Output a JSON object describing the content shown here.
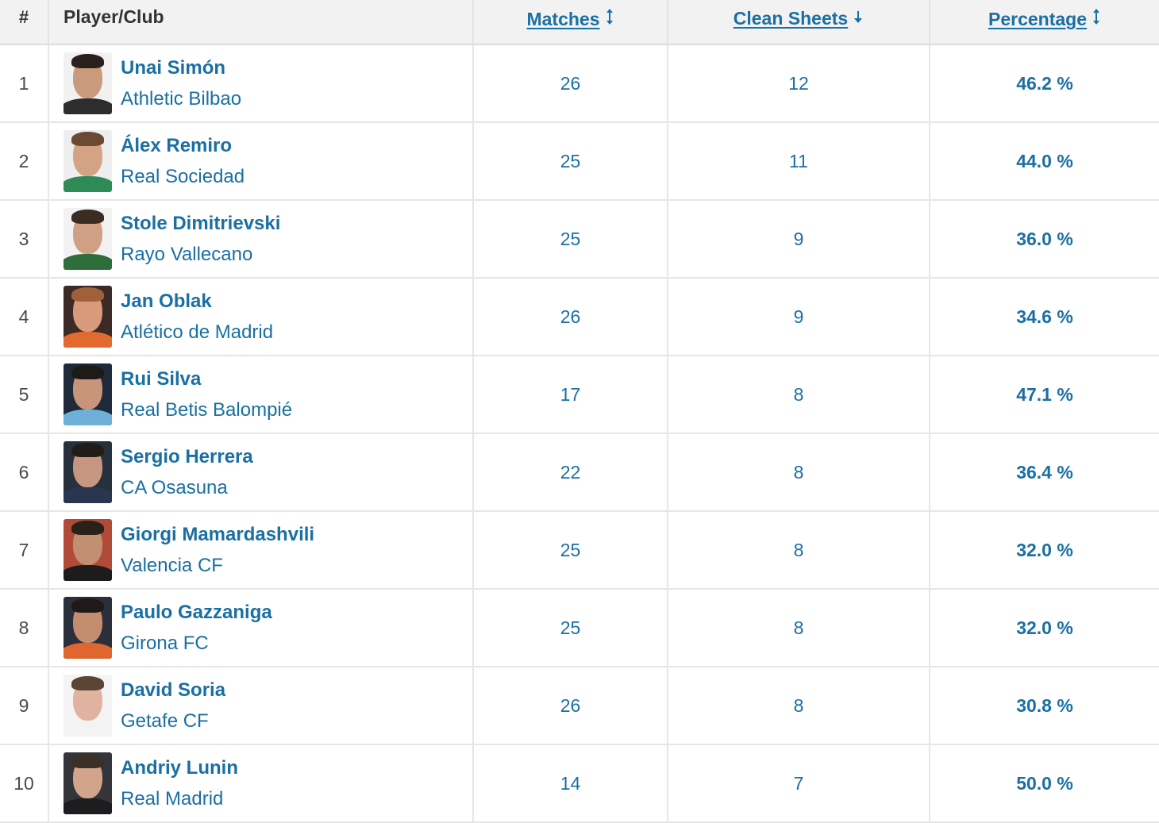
{
  "table": {
    "headers": {
      "rank": "#",
      "player_club": "Player/Club",
      "matches": "Matches",
      "clean_sheets": "Clean Sheets",
      "percentage": "Percentage"
    },
    "sort_icons": {
      "matches": "sort-both-icon",
      "clean_sheets": "sort-descending-icon",
      "percentage": "sort-both-icon"
    },
    "rows": [
      {
        "rank": "1",
        "player": "Unai Simón",
        "club": "Athletic Bilbao",
        "matches": "26",
        "clean_sheets": "12",
        "percentage": "46.2 %",
        "avatar": {
          "bg": "#f1f1f1",
          "skin": "#c99a7c",
          "hair": "#2b211c",
          "kit": "#2d2d2d"
        }
      },
      {
        "rank": "2",
        "player": "Álex Remiro",
        "club": "Real Sociedad",
        "matches": "25",
        "clean_sheets": "11",
        "percentage": "44.0 %",
        "avatar": {
          "bg": "#eeeeee",
          "skin": "#d4a386",
          "hair": "#6b4a34",
          "kit": "#2e8b57"
        }
      },
      {
        "rank": "3",
        "player": "Stole Dimitrievski",
        "club": "Rayo Vallecano",
        "matches": "25",
        "clean_sheets": "9",
        "percentage": "36.0 %",
        "avatar": {
          "bg": "#f2f2f2",
          "skin": "#cfa084",
          "hair": "#3a2c22",
          "kit": "#2f6e3a"
        }
      },
      {
        "rank": "4",
        "player": "Jan Oblak",
        "club": "Atlético de Madrid",
        "matches": "26",
        "clean_sheets": "9",
        "percentage": "34.6 %",
        "avatar": {
          "bg": "#3b2a26",
          "skin": "#d89a7a",
          "hair": "#a0603a",
          "kit": "#e36a2e"
        }
      },
      {
        "rank": "5",
        "player": "Rui Silva",
        "club": "Real Betis Balompié",
        "matches": "17",
        "clean_sheets": "8",
        "percentage": "47.1 %",
        "avatar": {
          "bg": "#1f2b3a",
          "skin": "#c9957a",
          "hair": "#1e1a18",
          "kit": "#6fb0d8"
        }
      },
      {
        "rank": "6",
        "player": "Sergio Herrera",
        "club": "CA Osasuna",
        "matches": "22",
        "clean_sheets": "8",
        "percentage": "36.4 %",
        "avatar": {
          "bg": "#27313d",
          "skin": "#c7967e",
          "hair": "#221c19",
          "kit": "#2a3550"
        }
      },
      {
        "rank": "7",
        "player": "Giorgi Mamardashvili",
        "club": "Valencia CF",
        "matches": "25",
        "clean_sheets": "8",
        "percentage": "32.0 %",
        "avatar": {
          "bg": "#b24a3a",
          "skin": "#c38f72",
          "hair": "#2a2119",
          "kit": "#1c1c1c"
        }
      },
      {
        "rank": "8",
        "player": "Paulo Gazzaniga",
        "club": "Girona FC",
        "matches": "25",
        "clean_sheets": "8",
        "percentage": "32.0 %",
        "avatar": {
          "bg": "#2a2f3a",
          "skin": "#c48d70",
          "hair": "#1f1a17",
          "kit": "#e0662f"
        }
      },
      {
        "rank": "9",
        "player": "David Soria",
        "club": "Getafe CF",
        "matches": "26",
        "clean_sheets": "8",
        "percentage": "30.8 %",
        "avatar": {
          "bg": "#f4f4f4",
          "skin": "#e0b3a0",
          "hair": "#5a4536",
          "kit": "#f3f3f3"
        }
      },
      {
        "rank": "10",
        "player": "Andriy Lunin",
        "club": "Real Madrid",
        "matches": "14",
        "clean_sheets": "7",
        "percentage": "50.0 %",
        "avatar": {
          "bg": "#33353a",
          "skin": "#d2a48c",
          "hair": "#3b2f27",
          "kit": "#1d1d1f"
        }
      }
    ]
  }
}
